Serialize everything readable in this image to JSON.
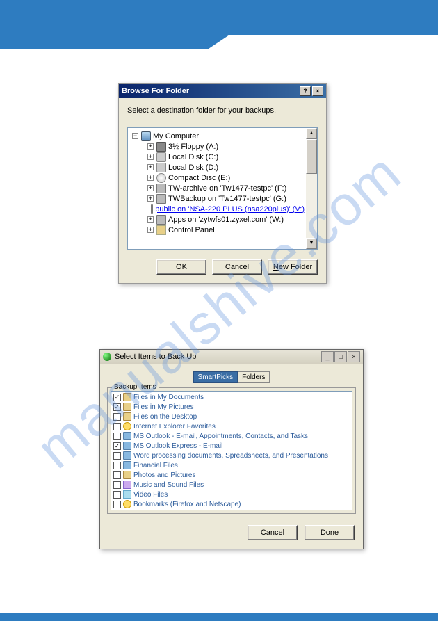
{
  "watermark": "manualshive.com",
  "dialog1": {
    "title": "Browse For Folder",
    "help_symbol": "?",
    "close_symbol": "×",
    "prompt": "Select a destination folder for your backups.",
    "tree": {
      "root": "My Computer",
      "items": [
        "3½ Floppy (A:)",
        "Local Disk (C:)",
        "Local Disk (D:)",
        "Compact Disc (E:)",
        "TW-archive on 'Tw1477-testpc' (F:)",
        "TWBackup on 'Tw1477-testpc' (G:)",
        "public on 'NSA-220 PLUS (nsa220plus)' (V:)",
        "Apps on 'zytwfs01.zyxel.com' (W:)",
        "Control Panel"
      ],
      "selected_index": 6
    },
    "buttons": {
      "ok": "OK",
      "cancel": "Cancel",
      "new_folder_prefix": "N",
      "new_folder_suffix": "ew Folder"
    }
  },
  "dialog2": {
    "title": "Select Items to Back Up",
    "min_symbol": "_",
    "max_symbol": "□",
    "close_symbol": "×",
    "tabs": {
      "active": "SmartPicks",
      "inactive": "Folders"
    },
    "group_label": "Backup Items",
    "items": [
      {
        "checked": true,
        "label": "Files in My Documents"
      },
      {
        "checked": true,
        "label": "Files in My Pictures"
      },
      {
        "checked": false,
        "label": "Files on the Desktop"
      },
      {
        "checked": false,
        "label": "Internet Explorer Favorites"
      },
      {
        "checked": false,
        "label": "MS Outlook - E-mail, Appointments, Contacts, and Tasks"
      },
      {
        "checked": true,
        "label": "MS Outlook Express - E-mail"
      },
      {
        "checked": false,
        "label": "Word processing documents, Spreadsheets, and Presentations"
      },
      {
        "checked": false,
        "label": "Financial Files"
      },
      {
        "checked": false,
        "label": "Photos and Pictures"
      },
      {
        "checked": false,
        "label": "Music and Sound Files"
      },
      {
        "checked": false,
        "label": "Video Files"
      },
      {
        "checked": false,
        "label": "Bookmarks (Firefox and Netscape)"
      }
    ],
    "buttons": {
      "cancel": "Cancel",
      "done": "Done"
    }
  }
}
